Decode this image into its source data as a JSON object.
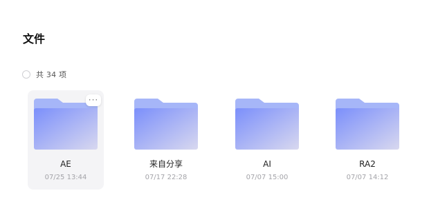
{
  "page": {
    "title": "文件"
  },
  "selection": {
    "count_label": "共 34 项"
  },
  "colors": {
    "folder_back": "#a3b4f8",
    "folder_front_start": "#7e92fb",
    "folder_front_end": "#d7d7ef",
    "active_card_bg": "#f4f4f6"
  },
  "files": [
    {
      "name": "AE",
      "date": "07/25 13:44",
      "icon": "folder-icon"
    },
    {
      "name": "来自分享",
      "date": "07/17 22:28",
      "icon": "folder-icon"
    },
    {
      "name": "AI",
      "date": "07/07 15:00",
      "icon": "folder-icon"
    },
    {
      "name": "RA2",
      "date": "07/07 14:12",
      "icon": "folder-icon"
    }
  ],
  "hover_menu": {
    "icon": "more-icon",
    "label": "···"
  }
}
